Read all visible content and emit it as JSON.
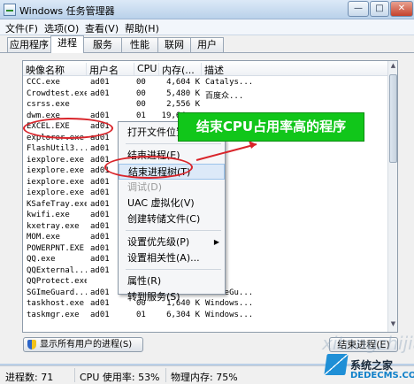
{
  "window": {
    "title": "Windows 任务管理器",
    "controls": [
      "—",
      "□",
      "✕"
    ]
  },
  "menu": [
    "文件(F)",
    "选项(O)",
    "查看(V)",
    "帮助(H)"
  ],
  "tabs": [
    "应用程序",
    "进程",
    "服务",
    "性能",
    "联网",
    "用户"
  ],
  "active_tab": "进程",
  "columns": [
    "映像名称",
    "用户名",
    "CPU",
    "内存(...",
    "描述"
  ],
  "processes": [
    [
      "CCC.exe",
      "ad01",
      "00",
      "4,604 K",
      "Catalys..."
    ],
    [
      "Crowdtest.exe",
      "ad01",
      "00",
      "5,480 K",
      "百度众..."
    ],
    [
      "csrss.exe",
      "",
      "00",
      "2,556 K",
      ""
    ],
    [
      "dwm.exe",
      "ad01",
      "01",
      "19,64...",
      ""
    ],
    [
      "EXCEL.EXE",
      "ad01",
      "",
      "",
      ""
    ],
    [
      "explorer.exe",
      "ad01",
      "",
      "",
      ""
    ],
    [
      "FlashUtil3...",
      "ad01",
      "",
      "",
      ""
    ],
    [
      "iexplore.exe",
      "ad01",
      "",
      "",
      ""
    ],
    [
      "iexplore.exe",
      "ad01",
      "",
      "",
      ""
    ],
    [
      "iexplore.exe",
      "ad01",
      "",
      "",
      ""
    ],
    [
      "iexplore.exe",
      "ad01",
      "",
      "",
      ""
    ],
    [
      "KSafeTray.exe",
      "ad01",
      "",
      "",
      ""
    ],
    [
      "kwifi.exe",
      "ad01",
      "",
      "",
      ""
    ],
    [
      "kxetray.exe",
      "ad01",
      "",
      "",
      ""
    ],
    [
      "MOM.exe",
      "ad01",
      "",
      "",
      ""
    ],
    [
      "POWERPNT.EXE",
      "ad01",
      "",
      "",
      ""
    ],
    [
      "QQ.exe",
      "ad01",
      "",
      "",
      ""
    ],
    [
      "QQExternal...",
      "ad01",
      "",
      "",
      ""
    ],
    [
      "QQProtect.exe",
      "",
      "",
      "",
      ""
    ],
    [
      "SGImeGuard...",
      "ad01",
      "00",
      "6,924 K",
      "SGImeGu..."
    ],
    [
      "taskhost.exe",
      "ad01",
      "00",
      "1,640 K",
      "Windows..."
    ],
    [
      "taskmgr.exe",
      "ad01",
      "01",
      "6,304 K",
      "Windows..."
    ]
  ],
  "context_menu": [
    {
      "label": "打开文件位置(O)",
      "disabled": false
    },
    {
      "sep": true
    },
    {
      "label": "结束进程(E)",
      "disabled": false
    },
    {
      "label": "结束进程树(T)",
      "disabled": false,
      "highlight": true
    },
    {
      "label": "调试(D)",
      "disabled": true
    },
    {
      "label": "UAC 虚拟化(V)",
      "disabled": false
    },
    {
      "label": "创建转储文件(C)",
      "disabled": false
    },
    {
      "sep": true
    },
    {
      "label": "设置优先级(P)",
      "disabled": false,
      "submenu": true
    },
    {
      "label": "设置相关性(A)...",
      "disabled": false
    },
    {
      "sep": true
    },
    {
      "label": "属性(R)",
      "disabled": false
    },
    {
      "label": "转到服务(S)",
      "disabled": false
    }
  ],
  "callout_text": "结束CPU占用率高的程序",
  "show_all_label": "显示所有用户的进程(S)",
  "end_process_label": "结束进程(E)",
  "status": {
    "processes": "进程数: 71",
    "cpu": "CPU 使用率: 53%",
    "memory": "物理内存: 75%"
  },
  "watermark": {
    "line1": "系统之家",
    "line2": "DEDECMS.COM",
    "faint": "xitongzhijia"
  },
  "colors": {
    "callout_bg": "#11c61a",
    "annotation_red": "#d9242a",
    "title_bar": "#dce9f7"
  }
}
